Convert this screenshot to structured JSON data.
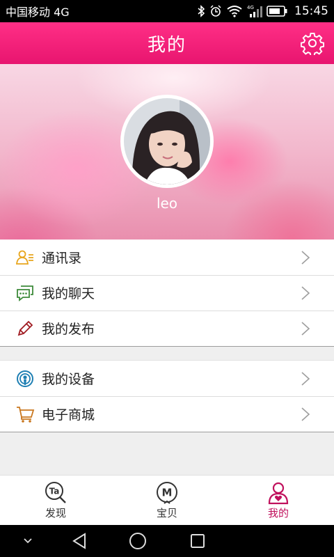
{
  "status_bar": {
    "carrier": "中国移动 4G",
    "network_badge": "4G",
    "time": "15:45"
  },
  "header": {
    "title": "我的",
    "settings_icon": "gear-icon"
  },
  "profile": {
    "username": "leo"
  },
  "menu_group_1": [
    {
      "label": "通讯录",
      "icon": "contacts-icon",
      "color": "#e8a51c"
    },
    {
      "label": "我的聊天",
      "icon": "chat-icon",
      "color": "#3d8a3a"
    },
    {
      "label": "我的发布",
      "icon": "pencil-icon",
      "color": "#a01b22"
    }
  ],
  "menu_group_2": [
    {
      "label": "我的设备",
      "icon": "device-icon",
      "color": "#1e7fb3"
    },
    {
      "label": "电子商城",
      "icon": "cart-icon",
      "color": "#c9771f"
    }
  ],
  "tabs": [
    {
      "label": "发现",
      "icon": "discover-icon",
      "icon_text": "Ta",
      "active": false
    },
    {
      "label": "宝贝",
      "icon": "baby-icon",
      "icon_text": "M",
      "active": false
    },
    {
      "label": "我的",
      "icon": "profile-icon",
      "active": true
    }
  ],
  "colors": {
    "accent": "#e8156f",
    "active_tab": "#c0105c"
  }
}
